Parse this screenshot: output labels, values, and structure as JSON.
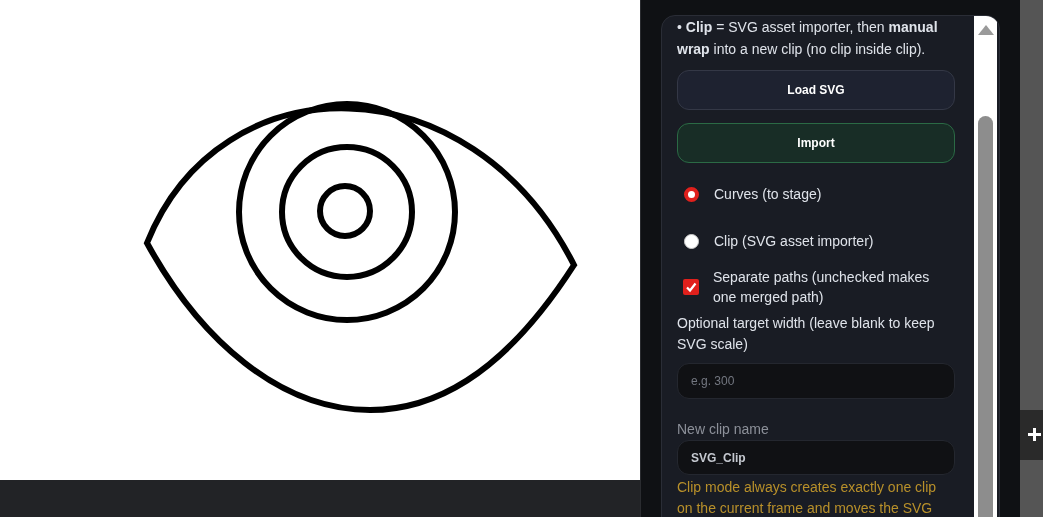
{
  "panel": {
    "intro": "• **Clip** = SVG asset importer, then **manual wrap** into a new clip (no clip inside clip).",
    "buttons": [
      {
        "label": "Load SVG",
        "kind": "neutral"
      },
      {
        "label": "Import",
        "kind": "primary"
      }
    ],
    "mode_options": [
      {
        "label": "Curves (to stage)",
        "selected": true
      },
      {
        "label": "Clip (SVG asset importer)",
        "selected": false
      }
    ],
    "separate_paths": {
      "label": "Separate paths (unchecked makes one merged path)",
      "checked": true
    },
    "target_width": {
      "label": "Optional target width (leave blank to keep SVG scale)",
      "placeholder": "e.g. 300"
    },
    "clip_name": {
      "label": "New clip name",
      "value": "SVG_Clip"
    },
    "note": "Clip mode always creates exactly one clip on the current frame and moves the SVG"
  }
}
